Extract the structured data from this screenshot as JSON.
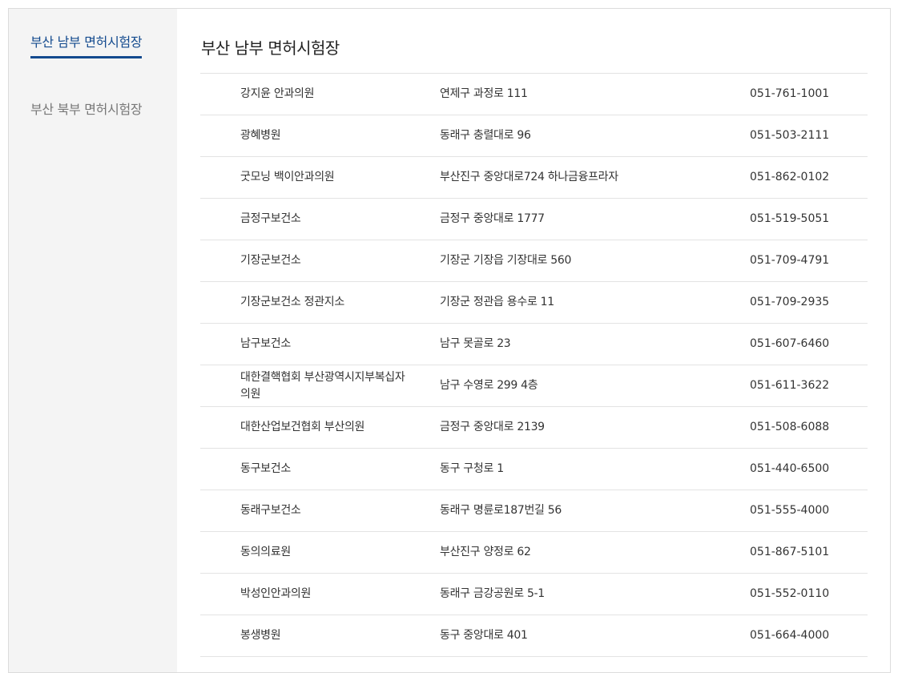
{
  "sidebar": {
    "items": [
      {
        "label": "부산 남부 면허시험장",
        "active": true
      },
      {
        "label": "부산 북부 면허시험장",
        "active": false
      }
    ]
  },
  "main": {
    "title": "부산 남부 면허시험장",
    "rows": [
      {
        "name": "강지윤 안과의원",
        "address": "연제구 과정로 111",
        "phone": "051-761-1001"
      },
      {
        "name": "광혜병원",
        "address": "동래구 충렬대로 96",
        "phone": "051-503-2111"
      },
      {
        "name": "굿모닝 백이안과의원",
        "address": "부산진구 중앙대로724 하나금융프라자",
        "phone": "051-862-0102"
      },
      {
        "name": "금정구보건소",
        "address": "금정구 중앙대로 1777",
        "phone": "051-519-5051"
      },
      {
        "name": "기장군보건소",
        "address": "기장군 기장읍 기장대로 560",
        "phone": "051-709-4791"
      },
      {
        "name": "기장군보건소 정관지소",
        "address": "기장군 정관읍 용수로 11",
        "phone": "051-709-2935"
      },
      {
        "name": "남구보건소",
        "address": "남구 못골로 23",
        "phone": "051-607-6460"
      },
      {
        "name": "대한결핵협회 부산광역시지부복십자의원",
        "address": "남구 수영로 299 4층",
        "phone": "051-611-3622"
      },
      {
        "name": "대한산업보건협회 부산의원",
        "address": "금정구 중앙대로 2139",
        "phone": "051-508-6088"
      },
      {
        "name": "동구보건소",
        "address": "동구 구청로 1",
        "phone": "051-440-6500"
      },
      {
        "name": "동래구보건소",
        "address": "동래구 명륜로187번길 56",
        "phone": "051-555-4000"
      },
      {
        "name": "동의의료원",
        "address": "부산진구 양정로 62",
        "phone": "051-867-5101"
      },
      {
        "name": "박성인안과의원",
        "address": "동래구 금강공원로 5-1",
        "phone": "051-552-0110"
      },
      {
        "name": "봉생병원",
        "address": "동구 중앙대로 401",
        "phone": "051-664-4000"
      }
    ]
  }
}
